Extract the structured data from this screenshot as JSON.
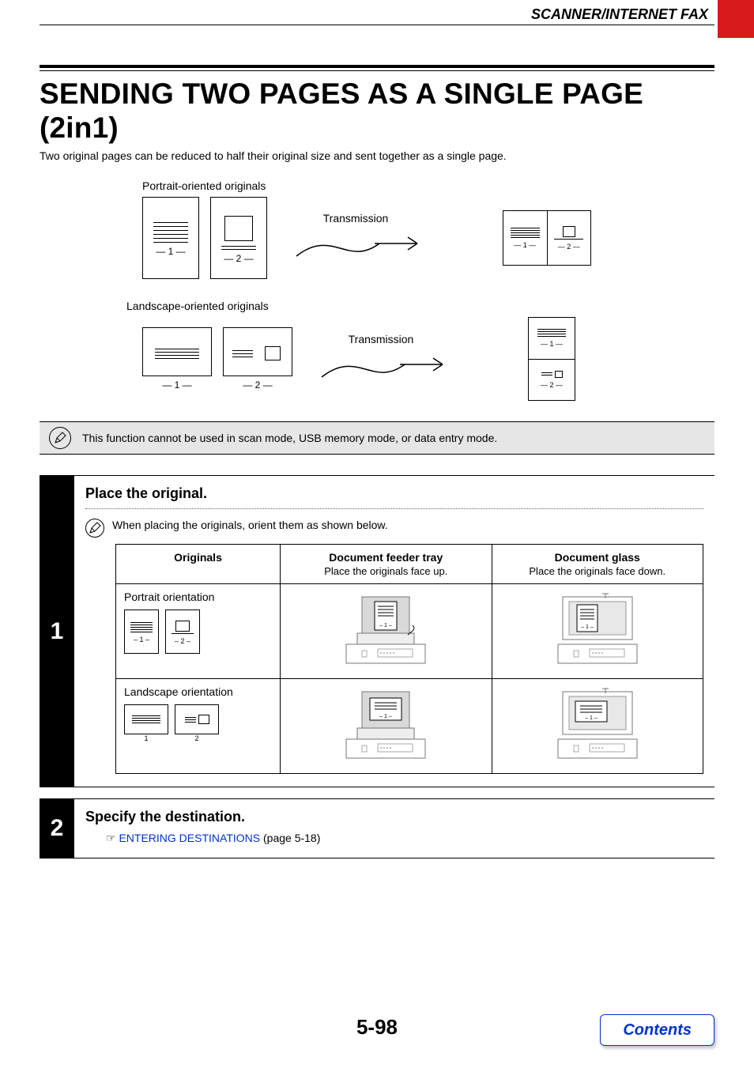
{
  "header": {
    "title": "SCANNER/INTERNET FAX"
  },
  "title": "SENDING TWO PAGES AS A SINGLE PAGE (2in1)",
  "intro": "Two original pages can be reduced to half their original size and sent together as a single page.",
  "diagram": {
    "portrait_label": "Portrait-oriented originals",
    "landscape_label": "Landscape-oriented originals",
    "transmission": "Transmission",
    "page1": "1",
    "page2": "2"
  },
  "note": "This function cannot be used in scan mode, USB memory mode, or data entry mode.",
  "steps": {
    "s1": {
      "num": "1",
      "title": "Place the original.",
      "subnote": "When placing the originals, orient them as shown below.",
      "table": {
        "h1": "Originals",
        "h2": "Document feeder tray",
        "h2sub": "Place the originals face up.",
        "h3": "Document glass",
        "h3sub": "Place the originals face down.",
        "r1": "Portrait orientation",
        "r2": "Landscape orientation"
      }
    },
    "s2": {
      "num": "2",
      "title": "Specify the destination.",
      "link": "ENTERING DESTINATIONS",
      "after": " (page 5-18)",
      "link_icon": "☞"
    }
  },
  "footer": {
    "pageno": "5-98",
    "contents": "Contents"
  }
}
